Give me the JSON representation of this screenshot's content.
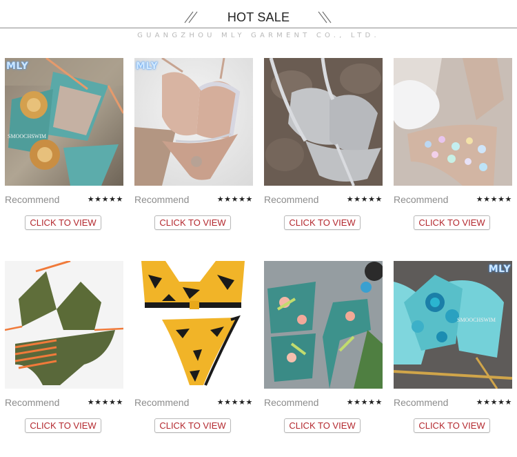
{
  "header": {
    "title_part1": "HOT",
    "title_part2": " SALE",
    "subtitle": "GUANGZHOU MLY GARMENT CO., LTD."
  },
  "products": [
    {
      "brand_tag": "MLY",
      "watermark": "SMOOCHSWIM",
      "rec_label": "Recommend",
      "stars": "★★★★★",
      "rating": 5,
      "button": "CLICK TO VIEW"
    },
    {
      "brand_tag": "MLY",
      "rec_label": "Recommend",
      "stars": "★★★★★",
      "rating": 5,
      "button": "CLICK TO VIEW"
    },
    {
      "rec_label": "Recommend",
      "stars": "★★★★★",
      "rating": 5,
      "button": "CLICK TO VIEW"
    },
    {
      "rec_label": "Recommend",
      "stars": "★★★★★",
      "rating": 5,
      "button": "CLICK TO VIEW"
    },
    {
      "rec_label": "Recommend",
      "stars": "★★★★★",
      "rating": 5,
      "button": "CLICK TO VIEW"
    },
    {
      "rec_label": "Recommend",
      "stars": "★★★★★",
      "rating": 5,
      "button": "CLICK TO VIEW"
    },
    {
      "rec_label": "Recommend",
      "stars": "★★★★★",
      "rating": 5,
      "button": "CLICK TO VIEW"
    },
    {
      "brand_tag": "MLY",
      "watermark": "SMOOCHSWIM",
      "rec_label": "Recommend",
      "stars": "★★★★★",
      "rating": 5,
      "button": "CLICK TO VIEW"
    }
  ],
  "colors": {
    "button_text": "#b3272d",
    "muted_text": "#8c8c8c"
  }
}
